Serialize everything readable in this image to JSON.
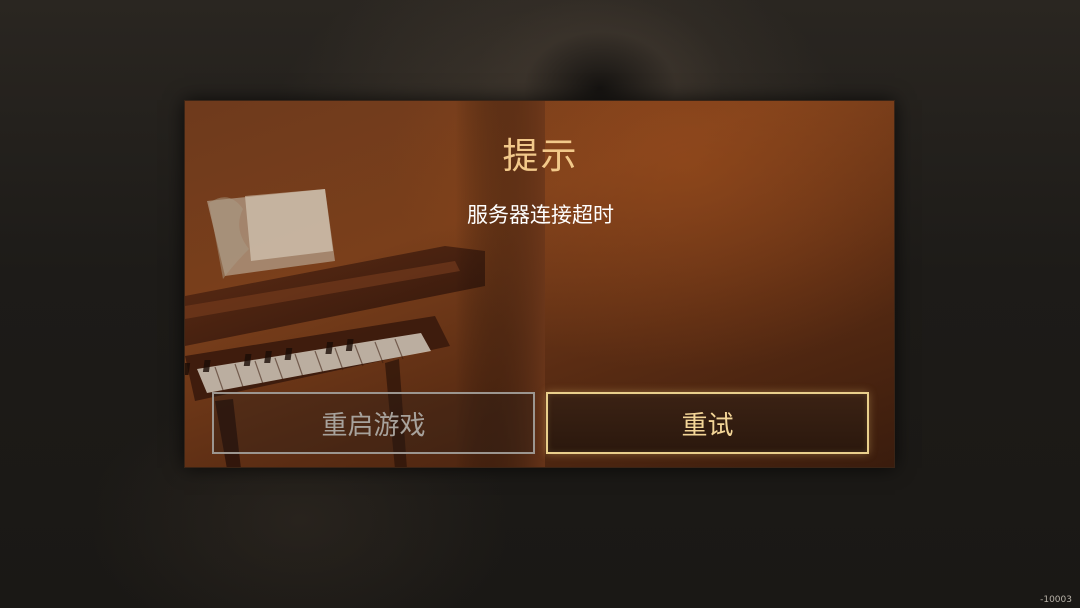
{
  "dialog": {
    "title": "提示",
    "message": "服务器连接超时",
    "buttons": {
      "restart_label": "重启游戏",
      "retry_label": "重试"
    }
  },
  "footer": {
    "version": "-10003"
  },
  "colors": {
    "title": "#f2c98a",
    "retry_border": "#e9cf8c",
    "restart_border": "#9c9690",
    "dialog_bg": "#6e3a1c"
  },
  "icons": {
    "background_art": "grand-piano-illustration"
  }
}
